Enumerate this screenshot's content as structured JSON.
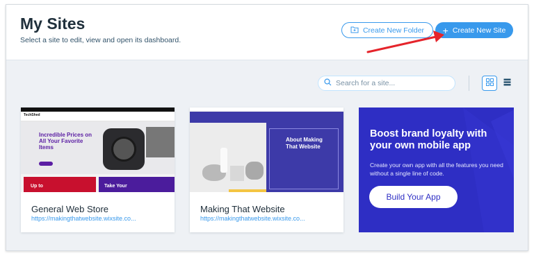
{
  "header": {
    "title": "My Sites",
    "subtitle": "Select a site to edit, view and open its dashboard.",
    "create_folder_label": "Create New Folder",
    "create_site_label": "Create New Site"
  },
  "toolbar": {
    "search_placeholder": "Search for a site...",
    "view_mode": "grid"
  },
  "sites": [
    {
      "name": "General Web Store",
      "url": "https://makingthatwebsite.wixsite.co...",
      "thumbnail": {
        "logo": "TechShed",
        "hero_text": "Incredible Prices on All Your Favorite Items",
        "banner_left": "Up to",
        "banner_right": "Take Your"
      }
    },
    {
      "name": "Making That Website",
      "url": "https://makingthatwebsite.wixsite.co...",
      "thumbnail": {
        "hero_text": "About Making That Website"
      }
    }
  ],
  "promo": {
    "title": "Boost brand loyalty with your own mobile app",
    "body": "Create your own app with all the features you need without a single line of code.",
    "button_label": "Build Your App"
  },
  "colors": {
    "accent": "#3899ec",
    "promo_bg": "#2e2ec4",
    "annotation_arrow": "#e5242b"
  }
}
